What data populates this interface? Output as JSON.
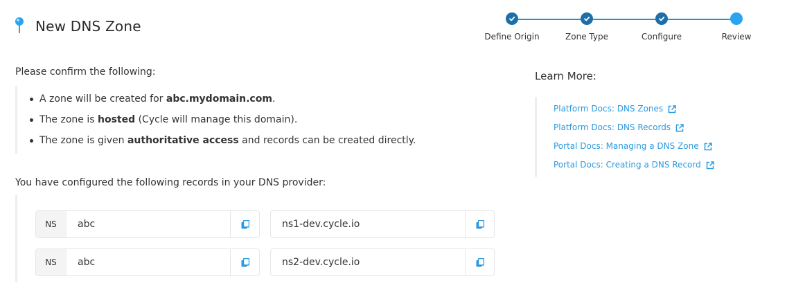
{
  "header": {
    "title": "New DNS Zone"
  },
  "stepper": {
    "steps": [
      {
        "label": "Define Origin",
        "state": "done"
      },
      {
        "label": "Zone Type",
        "state": "done"
      },
      {
        "label": "Configure",
        "state": "done"
      },
      {
        "label": "Review",
        "state": "current"
      }
    ]
  },
  "confirm": {
    "heading": "Please confirm the following:",
    "items": [
      {
        "pre": "A zone will be created for ",
        "bold": "abc.mydomain.com",
        "post": "."
      },
      {
        "pre": "The zone is ",
        "bold": "hosted",
        "post": " (Cycle will manage this domain)."
      },
      {
        "pre": "The zone is given ",
        "bold": "authoritative access",
        "post": " and records can be created directly."
      }
    ]
  },
  "records": {
    "heading": "You have configured the following records in your DNS provider:",
    "rows": [
      {
        "type": "NS",
        "name": "abc",
        "value": "ns1-dev.cycle.io"
      },
      {
        "type": "NS",
        "name": "abc",
        "value": "ns2-dev.cycle.io"
      }
    ]
  },
  "learn_more": {
    "heading": "Learn More:",
    "links": [
      {
        "label": "Platform Docs: DNS Zones"
      },
      {
        "label": "Platform Docs: DNS Records"
      },
      {
        "label": "Portal Docs: Managing a DNS Zone"
      },
      {
        "label": "Portal Docs: Creating a DNS Record"
      }
    ]
  },
  "colors": {
    "accent": "#2190d6",
    "step_done": "#1e6fa9",
    "step_current": "#2aa4ef",
    "link": "#2b9ae0"
  },
  "icons": {
    "title": "map-pin-icon",
    "step_done": "check-icon",
    "copy": "copy-icon",
    "link": "external-link-icon"
  }
}
